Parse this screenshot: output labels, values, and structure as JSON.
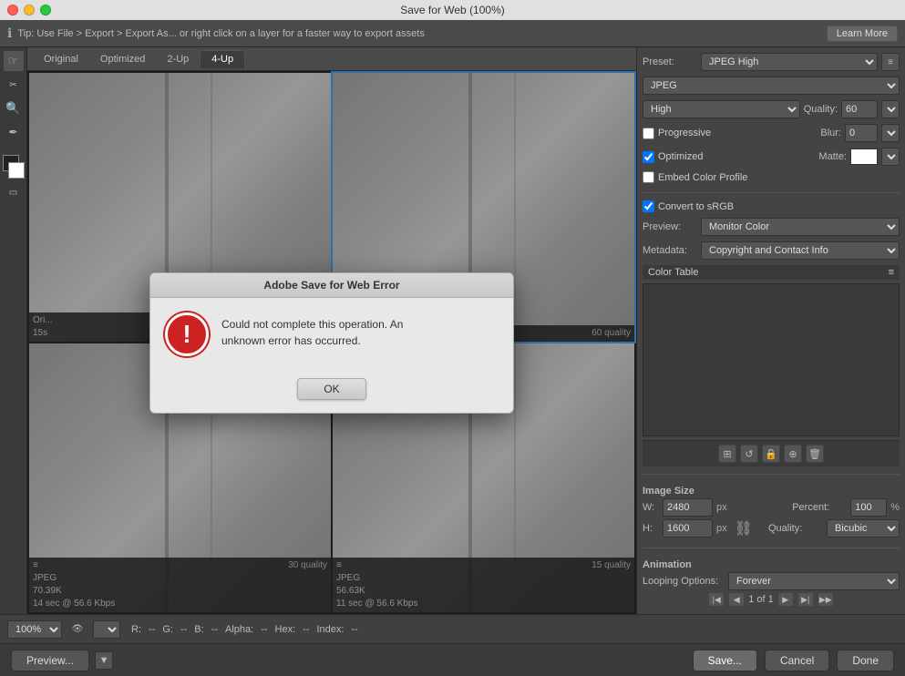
{
  "titlebar": {
    "title": "Save for Web (100%)"
  },
  "tipbar": {
    "tip": "Tip: Use File > Export > Export As... or right click on a layer for a faster way to export assets",
    "learn_more": "Learn More"
  },
  "tabs": [
    {
      "id": "original",
      "label": "Original"
    },
    {
      "id": "optimized",
      "label": "Optimized"
    },
    {
      "id": "2up",
      "label": "2-Up"
    },
    {
      "id": "4up",
      "label": "4-Up",
      "active": true
    }
  ],
  "canvas_cells": [
    {
      "id": "cell-1",
      "label_line1": "Ori...",
      "label_line2": "15s"
    },
    {
      "id": "cell-2",
      "quality_label": "60 quality",
      "selected": true
    },
    {
      "id": "cell-3",
      "format": "JPEG",
      "size": "70.39K",
      "time": "14 sec @ 56.6 Kbps",
      "quality_label": "30 quality"
    },
    {
      "id": "cell-4",
      "format": "JPEG",
      "size": "56.63K",
      "time": "11 sec @ 56.6 Kbps",
      "quality_label": "15 quality"
    }
  ],
  "right_panel": {
    "preset_label": "Preset:",
    "preset_value": "JPEG High",
    "format_value": "JPEG",
    "quality_level": "High",
    "quality_number": "60",
    "progressive_label": "Progressive",
    "progressive_checked": false,
    "blur_label": "Blur:",
    "blur_value": "0",
    "optimized_label": "Optimized",
    "optimized_checked": true,
    "matte_label": "Matte:",
    "embed_color_label": "Embed Color Profile",
    "embed_color_checked": false,
    "convert_srgb_label": "Convert to sRGB",
    "convert_srgb_checked": true,
    "preview_label": "Preview:",
    "preview_value": "Monitor Color",
    "metadata_label": "Metadata:",
    "metadata_value": "Copyright and Contact Info",
    "color_table_label": "Color Table",
    "image_size_label": "Image Size",
    "w_label": "W:",
    "w_value": "2480",
    "px_label": "px",
    "h_label": "H:",
    "h_value": "1600",
    "percent_label": "Percent:",
    "percent_value": "100",
    "quality_dropdown_label": "Quality:",
    "quality_dropdown_value": "Bicubic",
    "animation_label": "Animation",
    "looping_label": "Looping Options:",
    "looping_value": "Forever",
    "page_current": "1",
    "page_total": "1"
  },
  "status_bar": {
    "zoom": "100%",
    "r_label": "R:",
    "r_value": "--",
    "g_label": "G:",
    "g_value": "--",
    "b_label": "B:",
    "b_value": "--",
    "alpha_label": "Alpha:",
    "alpha_value": "--",
    "hex_label": "Hex:",
    "hex_value": "--",
    "index_label": "Index:",
    "index_value": "--"
  },
  "actions": {
    "preview_label": "Preview...",
    "save_label": "Save...",
    "cancel_label": "Cancel",
    "done_label": "Done"
  },
  "dialog": {
    "title": "Adobe Save for Web Error",
    "message_line1": "Could not complete this operation. An",
    "message_line2": "unknown error has occurred.",
    "ok_label": "OK"
  },
  "colors": {
    "accent_blue": "#4a9eff",
    "error_red": "#cc2222"
  }
}
